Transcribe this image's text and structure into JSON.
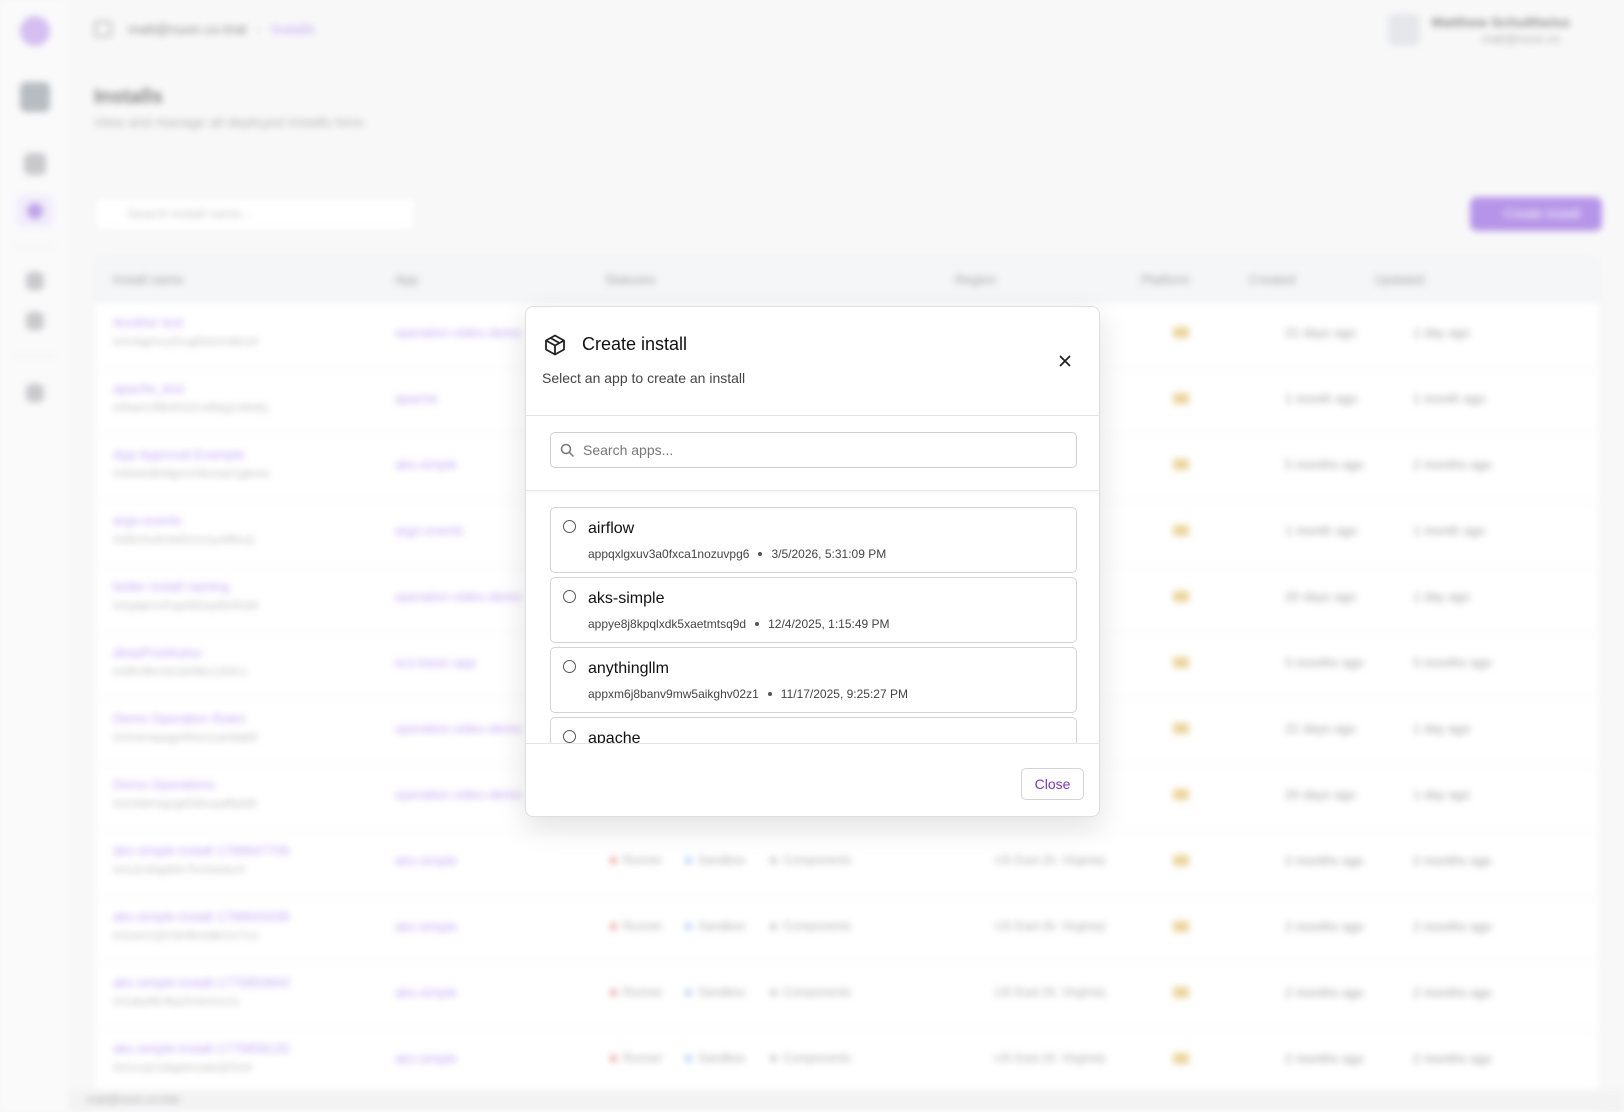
{
  "breadcrumb": {
    "org": "matt@nuon.co-trial",
    "current": "Installs"
  },
  "user": {
    "name": "Matthew Schultheiss",
    "email": "matt@nuon.co"
  },
  "page": {
    "title": "Installs",
    "subtitle": "View and manage all deployed installs here."
  },
  "toolbar": {
    "search_placeholder": "Search install name...",
    "create_label": "Create install"
  },
  "table": {
    "columns": [
      "Install name",
      "App",
      "Statuses",
      "Region",
      "Platform",
      "Created",
      "Updated"
    ],
    "rows": [
      {
        "name": "Another test",
        "id": "inl1nbgmxcyf1cgt9zb1mbk1ef",
        "app": "operation-video-demo",
        "created": "21 days ago",
        "updated": "1 day ago"
      },
      {
        "name": "apache_test",
        "id": "inl5aem3ftk451b1vd9eg1x8edxj",
        "app": "apache",
        "created": "1 month ago",
        "updated": "1 month ago"
      },
      {
        "name": "App Approval Example",
        "id": "inl3edsdk9dgm1hi6zwqri1gbs4o",
        "app": "aks-simple",
        "created": "5 months ago",
        "updated": "2 months ago"
      },
      {
        "name": "argo-events",
        "id": "inl3b1hudv4wf1i1rs1ys9lfxcjx",
        "app": "argo-events",
        "created": "1 month ago",
        "updated": "1 month ago"
      },
      {
        "name": "better install naming",
        "id": "inl1pbje1o51gofd2wy8fz0h2ld",
        "app": "operation-video-demo",
        "created": "20 days ago",
        "updated": "1 day ago"
      },
      {
        "name": "deepPostAutou",
        "id": "inl3fm9kro3o1b09kx120hc1",
        "app": "ecs-basic-app",
        "created": "5 months ago",
        "updated": "5 months ago"
      },
      {
        "name": "Demo Operation Roles",
        "id": "inl1h4mepagnf3hw11ar0dqf0f",
        "app": "operation-video-demo",
        "created": "21 days ago",
        "updated": "1 day ago"
      },
      {
        "name": "Demo Operations",
        "id": "inl1o9dmsg1gd1fdvcpaffq3d9",
        "app": "operation-video-demo",
        "created": "20 days ago",
        "updated": "1 day ago"
      },
      {
        "name": "aks-simple-install-1768647706",
        "id": "inl1a1rd0gdt3c7hc0swdur4",
        "app": "aks-simple",
        "runner": "Runner",
        "sandbox": "Sandbox",
        "components": "Components",
        "region": "US East (N. Virginia)",
        "created": "2 months ago",
        "updated": "2 months ago"
      },
      {
        "name": "aks-simple-install-1768643439",
        "id": "inl1eem1j0r1br8kvsdbn1c7crx",
        "app": "aks-simple",
        "runner": "Runner",
        "sandbox": "Sandbox",
        "components": "Components",
        "region": "US East (N. Virginia)",
        "created": "2 months ago",
        "updated": "2 months ago"
      },
      {
        "name": "aks-simple-install-1775850843",
        "id": "inl1aby9fc3fq15n3mh1r21",
        "app": "aks-simple",
        "runner": "Runner",
        "sandbox": "Sandbox",
        "components": "Components",
        "region": "US East (N. Virginia)",
        "created": "2 months ago",
        "updated": "2 months ago"
      },
      {
        "name": "aks-simple-install-1775858120",
        "id": "inl1xcvjn1abgdm1akeqf1hs4",
        "app": "aks-simple",
        "runner": "Runner",
        "sandbox": "Sandbox",
        "components": "Components",
        "region": "US East (N. Virginia)",
        "created": "2 months ago",
        "updated": "2 months ago"
      }
    ]
  },
  "footer": {
    "text": "matt@nuon.co-trial"
  },
  "modal": {
    "title": "Create install",
    "subtitle": "Select an app to create an install",
    "search_placeholder": "Search apps...",
    "apps": [
      {
        "name": "airflow",
        "id": "appqxlgxuv3a0fxca1nozuvpg6",
        "date": "3/5/2026, 5:31:09 PM"
      },
      {
        "name": "aks-simple",
        "id": "appye8j8kpqlxdk5xaetmtsq9d",
        "date": "12/4/2025, 1:15:49 PM"
      },
      {
        "name": "anythingllm",
        "id": "appxm6j8banv9mw5aikghv02z1",
        "date": "11/17/2025, 9:25:27 PM"
      },
      {
        "name": "apache",
        "id": "",
        "date": ""
      }
    ],
    "close_label": "Close",
    "icons": {
      "title": "package-icon",
      "close": "close-icon",
      "search": "search-icon"
    }
  }
}
